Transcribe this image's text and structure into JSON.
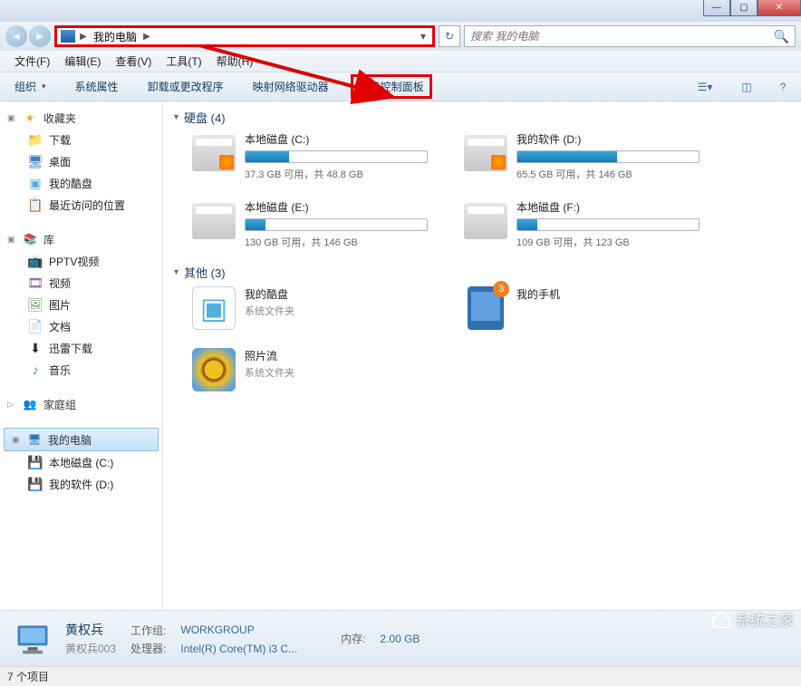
{
  "titlebar": {
    "minimize": "—",
    "maximize": "▢",
    "close": "✕"
  },
  "nav": {
    "breadcrumb_text": "我的电脑",
    "search_placeholder": "搜索 我的电脑"
  },
  "menubar": [
    "文件(F)",
    "编辑(E)",
    "查看(V)",
    "工具(T)",
    "帮助(H)"
  ],
  "toolbar": {
    "organize": "组织",
    "system_props": "系统属性",
    "uninstall": "卸载或更改程序",
    "map_drive": "映射网络驱动器",
    "control_panel": "打开控制面板"
  },
  "sidebar": {
    "favorites": {
      "label": "收藏夹",
      "items": [
        "下载",
        "桌面",
        "我的酷盘",
        "最近访问的位置"
      ]
    },
    "libraries": {
      "label": "库",
      "items": [
        "PPTV视频",
        "视频",
        "图片",
        "文档",
        "迅雷下载",
        "音乐"
      ]
    },
    "homegroup": {
      "label": "家庭组"
    },
    "computer": {
      "label": "我的电脑",
      "items": [
        "本地磁盘 (C:)",
        "我的软件 (D:)"
      ]
    }
  },
  "content": {
    "drives_header": "硬盘 (4)",
    "drives": [
      {
        "name": "本地磁盘 (C:)",
        "space": "37.3 GB 可用，共 48.8 GB",
        "pct": 24,
        "system": true
      },
      {
        "name": "我的软件 (D:)",
        "space": "65.5 GB 可用，共 146 GB",
        "pct": 55,
        "system": true
      },
      {
        "name": "本地磁盘 (E:)",
        "space": "130 GB 可用，共 146 GB",
        "pct": 11,
        "system": false
      },
      {
        "name": "本地磁盘 (F:)",
        "space": "109 GB 可用，共 123 GB",
        "pct": 11,
        "system": false
      }
    ],
    "others_header": "其他 (3)",
    "others": [
      {
        "name": "我的酷盘",
        "desc": "系统文件夹",
        "icon": "kupan"
      },
      {
        "name": "我的手机",
        "desc": "",
        "icon": "phone",
        "badge": "3"
      },
      {
        "name": "照片流",
        "desc": "系统文件夹",
        "icon": "sunflower"
      }
    ]
  },
  "details": {
    "name": "黄权兵",
    "sub": "黄权兵003",
    "workgroup_lbl": "工作组:",
    "workgroup": "WORKGROUP",
    "cpu_lbl": "处理器:",
    "cpu": "Intel(R) Core(TM) i3 C...",
    "mem_lbl": "内存:",
    "mem": "2.00 GB"
  },
  "statusbar": {
    "text": "7 个项目"
  },
  "watermark": "系统之家"
}
